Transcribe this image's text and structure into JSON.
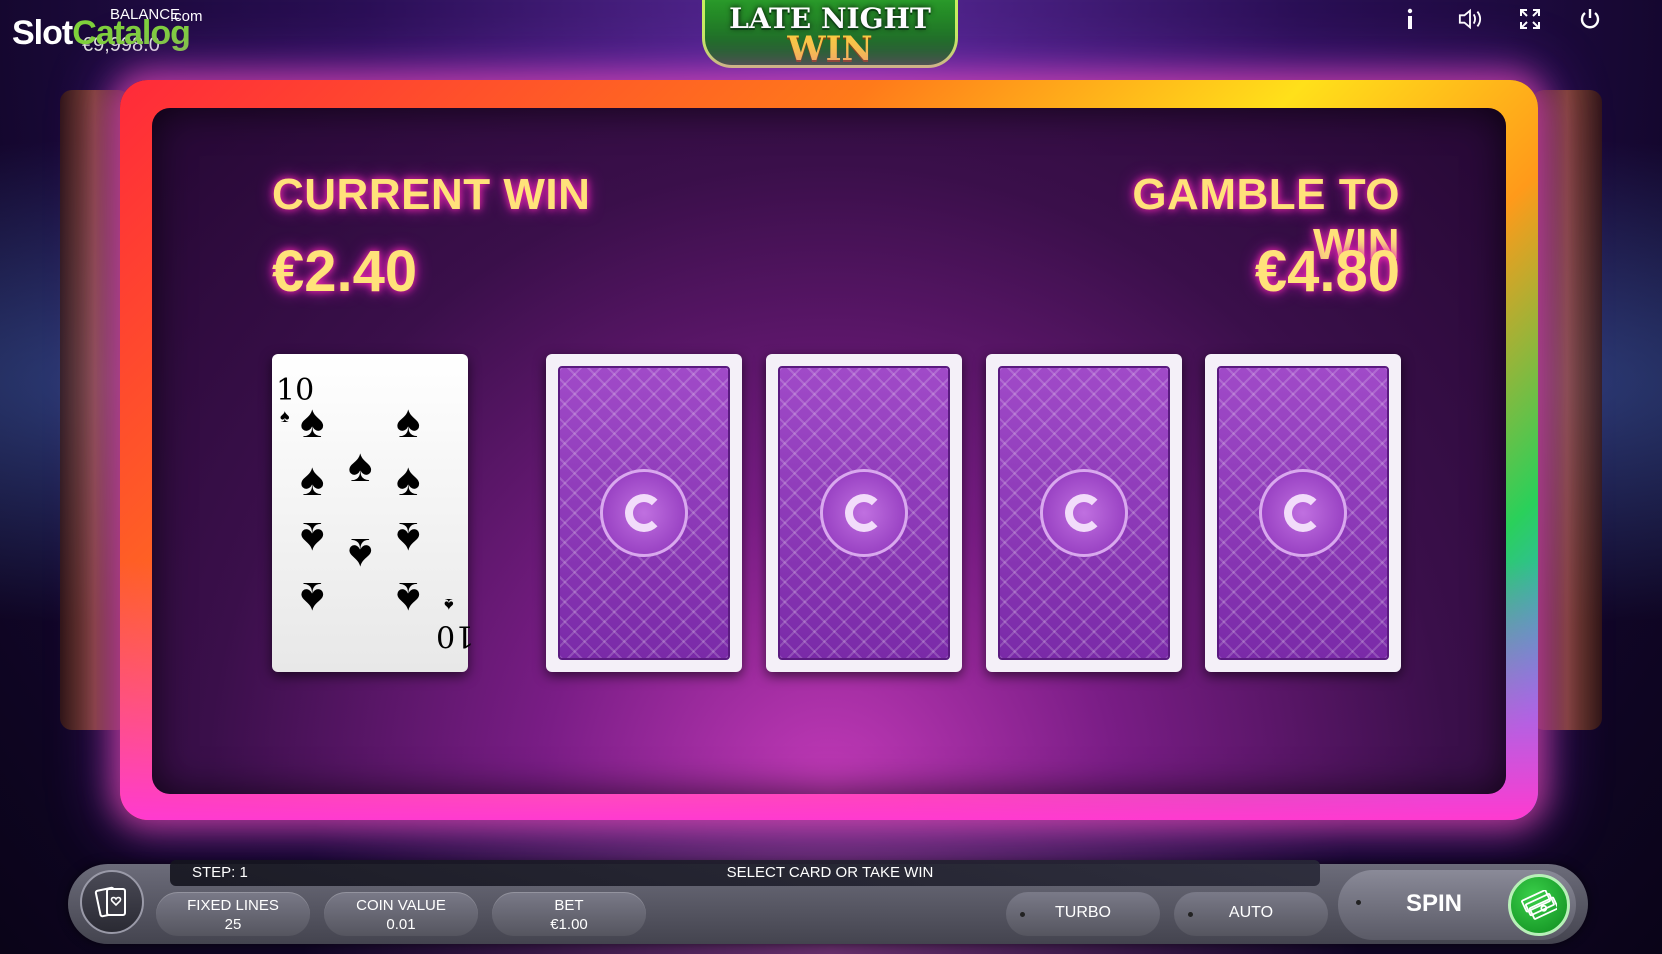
{
  "watermark": {
    "slot": "Slot",
    "catalog": "Catalog",
    "com": ".com"
  },
  "balance": {
    "label": "BALANCE",
    "value": "€9,998.0"
  },
  "logo": {
    "line1": "LATE NIGHT",
    "line2": "WIN"
  },
  "top_icons": [
    "info-icon",
    "sound-icon",
    "fullscreen-icon",
    "power-icon"
  ],
  "gamble": {
    "current_win_label": "CURRENT WIN",
    "current_win_value": "€2.40",
    "gamble_to_win_label": "GAMBLE TO WIN",
    "gamble_to_win_value": "€4.80",
    "dealer_card": {
      "rank": "10",
      "suit": "spades"
    },
    "hidden_cards": 4
  },
  "bottom": {
    "step": "STEP: 1",
    "status": "SELECT CARD OR TAKE WIN",
    "fixed_lines_label": "FIXED LINES",
    "fixed_lines_value": "25",
    "coin_value_label": "COIN VALUE",
    "coin_value_value": "0.01",
    "bet_label": "BET",
    "bet_value": "€1.00",
    "turbo_label": "TURBO",
    "auto_label": "AUTO",
    "spin_label": "SPIN"
  },
  "colors": {
    "win_text": "#ffe27a",
    "spin_green": "#1fae2e",
    "panel": "#3a0f4a"
  }
}
